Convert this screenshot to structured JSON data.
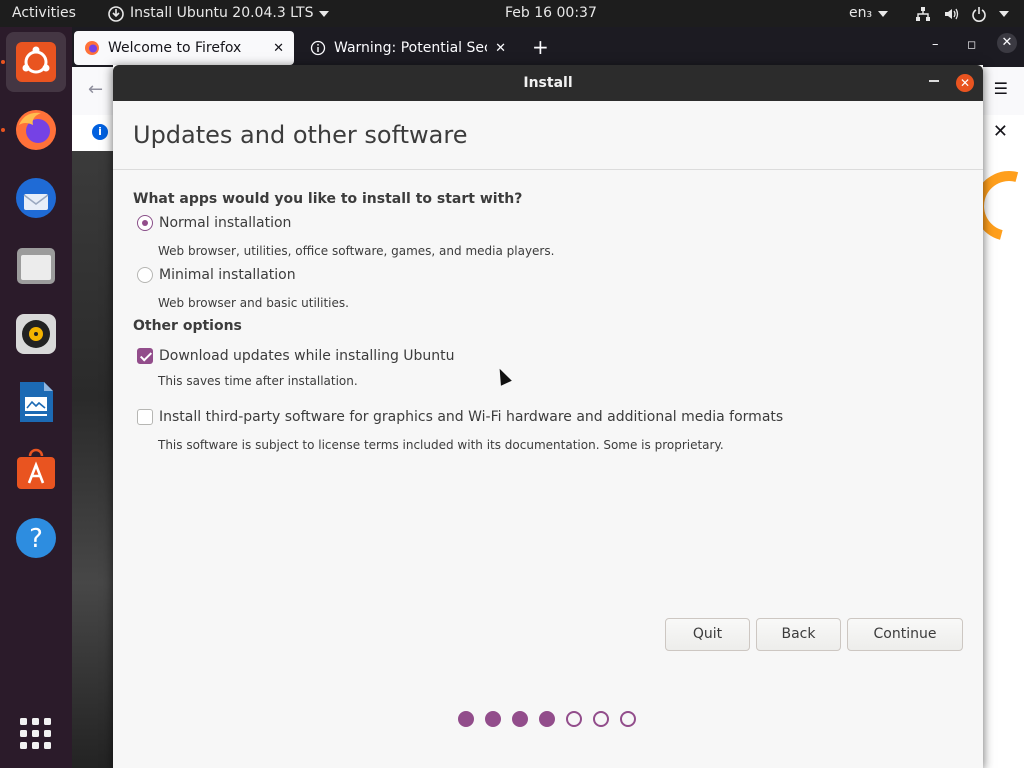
{
  "topbar": {
    "activities": "Activities",
    "app_title": "Install Ubuntu 20.04.3 LTS",
    "clock": "Feb 16  00:37",
    "language": "en₃"
  },
  "dock": {
    "items": [
      "ubuntu-installer",
      "firefox",
      "thunderbird",
      "files",
      "rhythmbox",
      "libreoffice-writer",
      "ubuntu-software",
      "help",
      "show-applications"
    ]
  },
  "firefox": {
    "tabs": [
      {
        "label": "Welcome to Firefox",
        "active": true
      },
      {
        "label": "Warning: Potential Securi",
        "active": false
      }
    ]
  },
  "dialog": {
    "title": "Install",
    "heading": "Updates and other software",
    "question": "What apps would you like to install to start with?",
    "options": [
      {
        "label": "Normal installation",
        "description": "Web browser, utilities, office software, games, and media players.",
        "selected": true
      },
      {
        "label": "Minimal installation",
        "description": "Web browser and basic utilities.",
        "selected": false
      }
    ],
    "other_options_heading": "Other options",
    "checks": [
      {
        "label": "Download updates while installing Ubuntu",
        "description": "This saves time after installation.",
        "checked": true
      },
      {
        "label": "Install third-party software for graphics and Wi-Fi hardware and additional media formats",
        "description": "This software is subject to license terms included with its documentation. Some is proprietary.",
        "checked": false
      }
    ],
    "buttons": {
      "quit": "Quit",
      "back": "Back",
      "continue": "Continue"
    },
    "progress": {
      "completed_steps": 4,
      "total_steps": 7
    }
  },
  "colors": {
    "accent": "#924d8b",
    "ubuntu_orange": "#e95420"
  }
}
